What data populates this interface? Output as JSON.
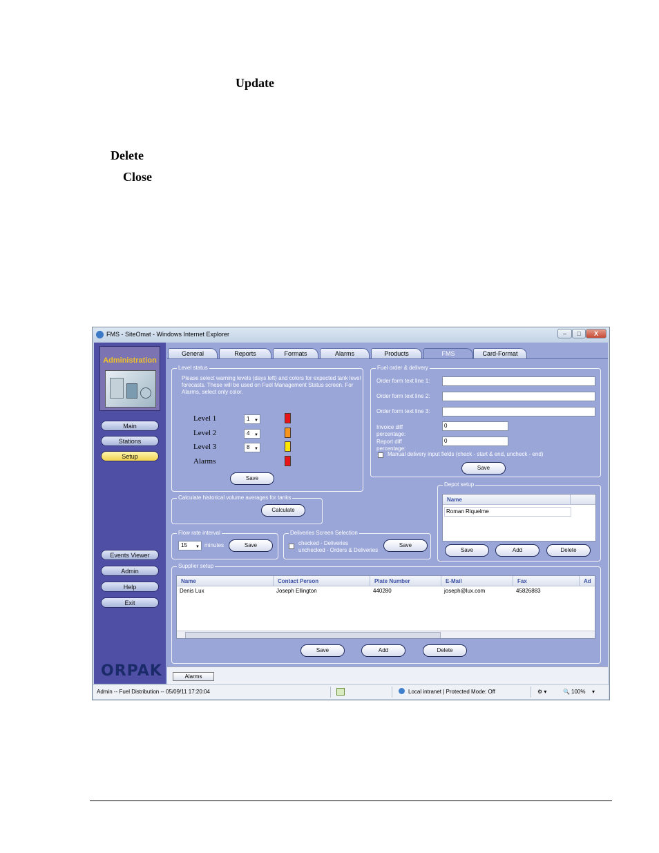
{
  "document": {
    "words": {
      "update": "Update",
      "delete": "Delete",
      "close": "Close"
    }
  },
  "window": {
    "title": "FMS - SiteOmat - Windows Internet Explorer",
    "controls": {
      "minimize": "–",
      "maximize": "□",
      "close": "X"
    }
  },
  "sidebar": {
    "module_title": "Administration",
    "nav": {
      "main": "Main",
      "stations": "Stations",
      "setup": "Setup"
    },
    "bottom": {
      "events_viewer": "Events Viewer",
      "admin": "Admin",
      "help": "Help",
      "exit": "Exit"
    },
    "brand": "ORPAK"
  },
  "tabs": [
    "General",
    "Reports",
    "Formats",
    "Alarms",
    "Products",
    "FMS",
    "Card-Format"
  ],
  "active_tab": "FMS",
  "level_status": {
    "title": "Level status",
    "instructions": "Please select warning levels (days left) and colors for expected tank level forecasts. These will be used on Fuel Management Status screen. For Alarms, select only color.",
    "levels": [
      {
        "label": "Level 1",
        "value": "1",
        "color": "#e8141b"
      },
      {
        "label": "Level 2",
        "value": "4",
        "color": "#f7941d"
      },
      {
        "label": "Level 3",
        "value": "8",
        "color": "#ffe600"
      },
      {
        "label": "Alarms",
        "color": "#e8141b"
      }
    ],
    "save": "Save"
  },
  "fuel_order": {
    "title": "Fuel order & delivery",
    "line1_label": "Order form text line 1:",
    "line2_label": "Order form text line 2:",
    "line3_label": "Order form text line 3:",
    "line1": "",
    "line2": "",
    "line3": "",
    "invoice_label": "Invoice diff percentage:",
    "invoice_value": "0",
    "report_label": "Report diff percentage:",
    "report_value": "0",
    "manual_label": "Manual delivery input fields (check - start & end, uncheck - end)",
    "save": "Save"
  },
  "historical": {
    "title": "Calculate historical volume averages for tanks",
    "calculate": "Calculate"
  },
  "flow_rate": {
    "title": "Flow rate interval",
    "value": "15",
    "unit": "minutes",
    "save": "Save"
  },
  "deliveries": {
    "title": "Deliveries Screen Selection",
    "checked": "checked - Deliveries",
    "unchecked": "unchecked - Orders & Deliveries",
    "save": "Save"
  },
  "depot": {
    "title": "Depot setup",
    "column": "Name",
    "rows": [
      "Roman Riquelme"
    ],
    "save": "Save",
    "add": "Add",
    "delete": "Delete"
  },
  "supplier": {
    "title": "Supplier setup",
    "columns": [
      "Name",
      "Contact Person",
      "Plate Number",
      "E-Mail",
      "Fax",
      "Ad"
    ],
    "rows": [
      [
        "Denis Lux",
        "Joseph Ellington",
        "440280",
        "joseph@lux.com",
        "45826883"
      ]
    ],
    "save": "Save",
    "add": "Add",
    "delete": "Delete"
  },
  "bottom_button": "Alarms",
  "status_bar": {
    "left": "Admin -- Fuel Distribution -- 05/09/11 17:20:04",
    "zone": "Local intranet | Protected Mode: Off",
    "zoom": "100%"
  }
}
